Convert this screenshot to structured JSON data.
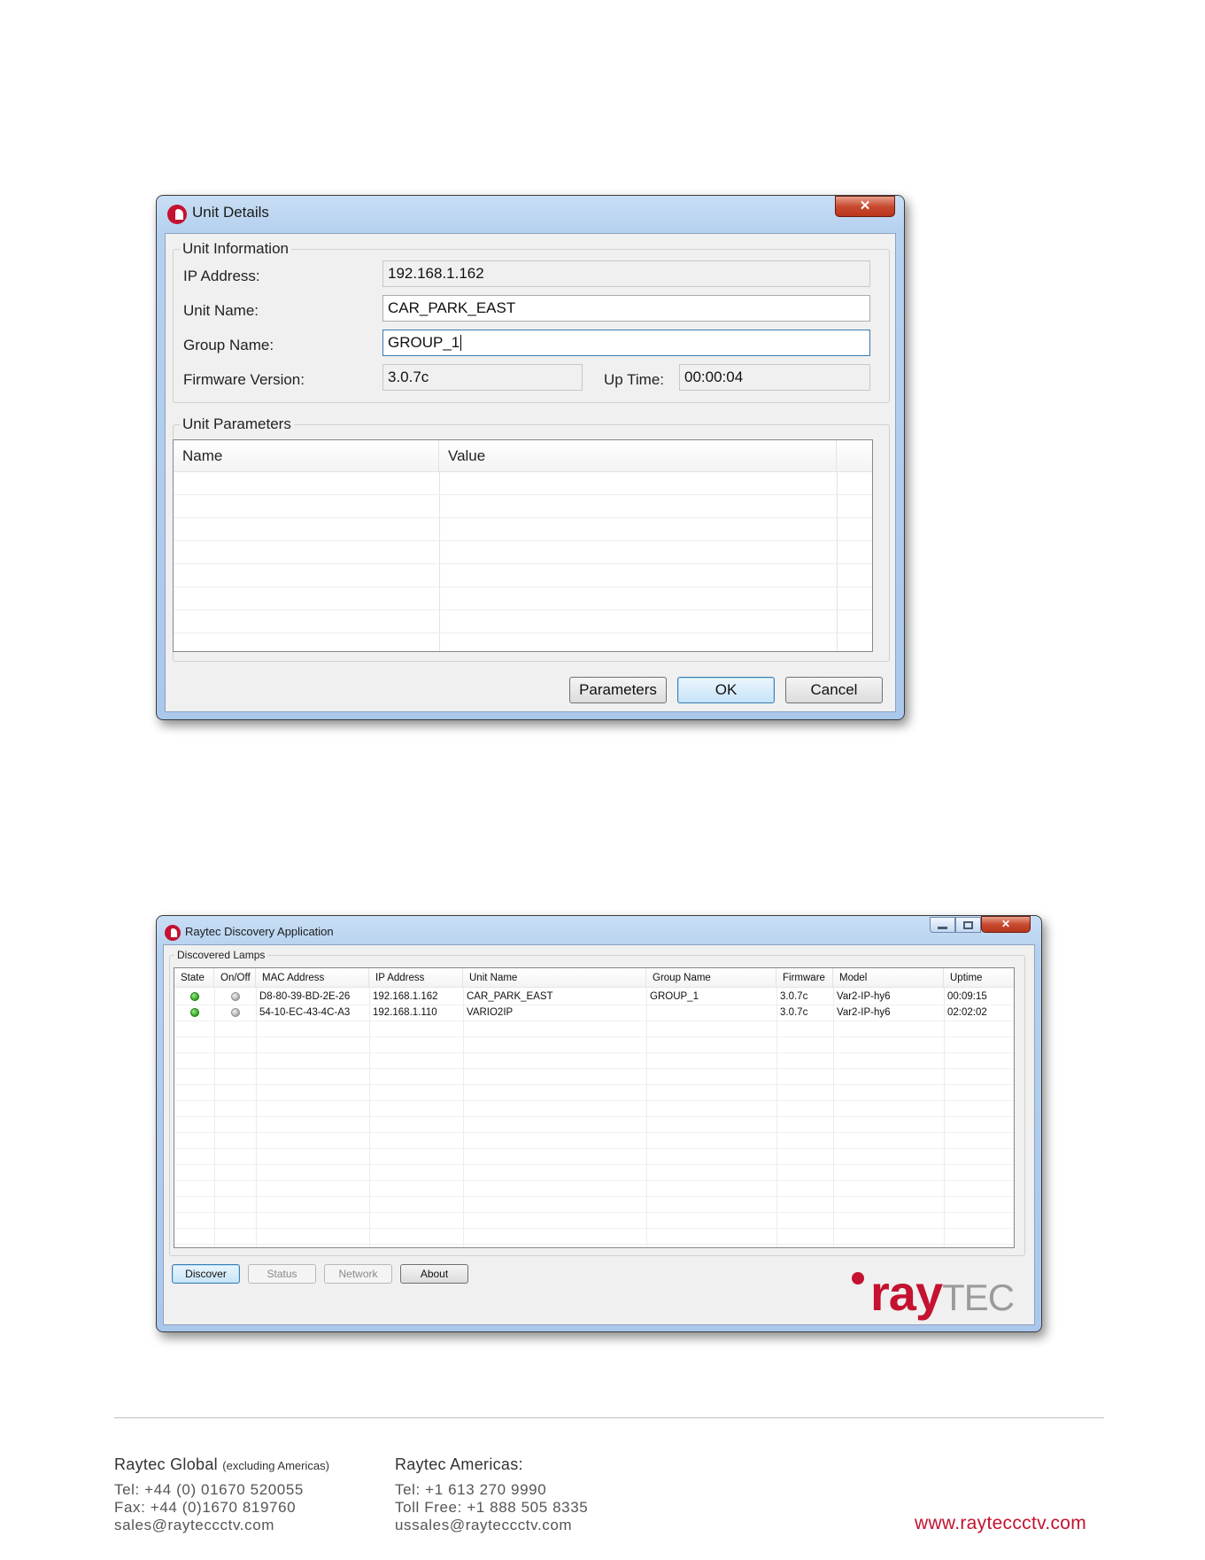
{
  "unit_details": {
    "title": "Unit Details",
    "close_label": "✕",
    "unit_information": {
      "group_label": "Unit Information",
      "ip_label": "IP Address:",
      "ip_value": "192.168.1.162",
      "unit_name_label": "Unit Name:",
      "unit_name_value": "CAR_PARK_EAST",
      "group_name_label": "Group Name:",
      "group_name_value": "GROUP_1",
      "firmware_label": "Firmware Version:",
      "firmware_value": "3.0.7c",
      "uptime_label": "Up Time:",
      "uptime_value": "00:00:04"
    },
    "unit_parameters": {
      "group_label": "Unit Parameters",
      "columns": [
        "Name",
        "Value"
      ]
    },
    "buttons": {
      "parameters": "Parameters",
      "ok": "OK",
      "cancel": "Cancel"
    }
  },
  "discovery": {
    "title": "Raytec Discovery Application",
    "close_label": "✕",
    "group_label": "Discovered Lamps",
    "columns": [
      "State",
      "On/Off",
      "MAC Address",
      "IP Address",
      "Unit Name",
      "Group Name",
      "Firmware",
      "Model",
      "Uptime"
    ],
    "rows": [
      {
        "state": "green",
        "onoff": "grey",
        "mac": "D8-80-39-BD-2E-26",
        "ip": "192.168.1.162",
        "unit_name": "CAR_PARK_EAST",
        "group_name": "GROUP_1",
        "firmware": "3.0.7c",
        "model": "Var2-IP-hy6",
        "uptime": "00:09:15"
      },
      {
        "state": "green",
        "onoff": "grey",
        "mac": "54-10-EC-43-4C-A3",
        "ip": "192.168.1.110",
        "unit_name": "VARIO2IP",
        "group_name": "",
        "firmware": "3.0.7c",
        "model": "Var2-IP-hy6",
        "uptime": "02:02:02"
      }
    ],
    "buttons": {
      "discover": "Discover",
      "status": "Status",
      "network": "Network",
      "about": "About"
    },
    "brand_ray": "ray",
    "brand_tec": "TEC"
  },
  "footer": {
    "global_heading": "Raytec Global",
    "global_note": "(excluding Americas)",
    "global_tel": "Tel: +44 (0) 01670 520055",
    "global_fax": "Fax: +44 (0)1670 819760",
    "global_email": "sales@raytecсctv.com",
    "americas_heading": "Raytec Americas:",
    "americas_tel": "Tel: +1 613 270 9990",
    "americas_tollfree": "Toll Free: +1 888 505 8335",
    "americas_email": "ussales@raytecсctv.com",
    "website": "www.raytecсctv.com"
  },
  "colors": {
    "brand_red": "#c41230",
    "status_green": "#2ea51c",
    "status_grey": "#a9a9a9"
  }
}
